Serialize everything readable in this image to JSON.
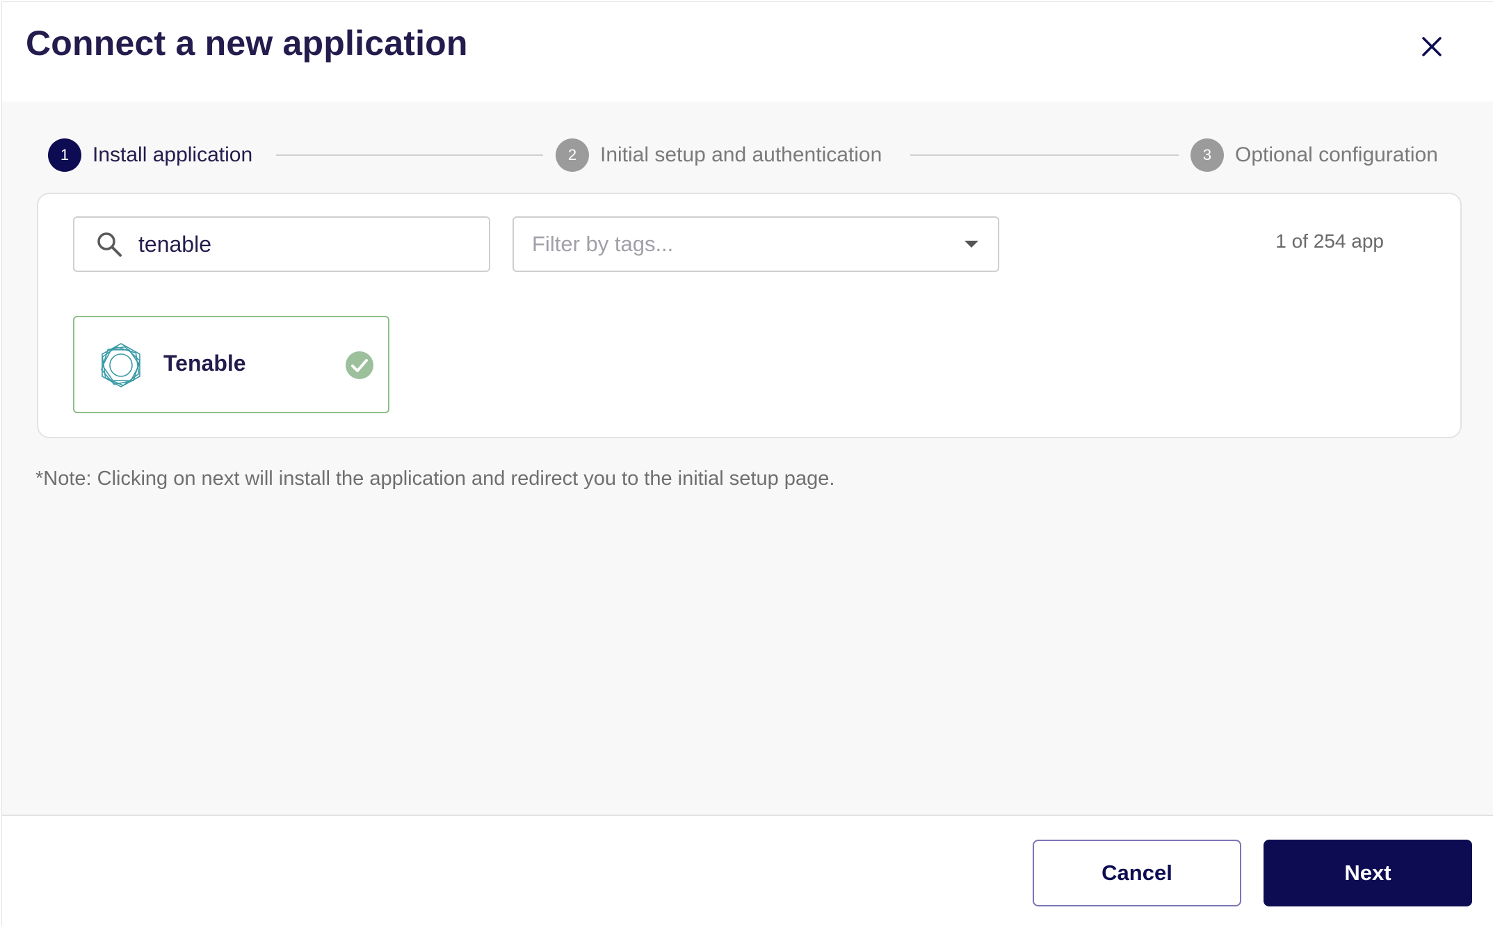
{
  "dialog": {
    "title": "Connect a new application",
    "close_icon": "close-icon"
  },
  "stepper": {
    "steps": [
      {
        "number": "1",
        "label": "Install application",
        "state": "active"
      },
      {
        "number": "2",
        "label": "Initial setup and authentication",
        "state": "inactive"
      },
      {
        "number": "3",
        "label": "Optional configuration",
        "state": "inactive"
      }
    ]
  },
  "search": {
    "value": "tenable",
    "icon": "search-icon"
  },
  "filter": {
    "placeholder": "Filter by tags..."
  },
  "results": {
    "count_text": "1 of 254 app",
    "apps": [
      {
        "name": "Tenable",
        "selected": true,
        "icon": "tenable-logo-icon"
      }
    ]
  },
  "note": "*Note: Clicking on next will install the application and redirect you to the initial setup page.",
  "footer": {
    "cancel_label": "Cancel",
    "next_label": "Next"
  },
  "colors": {
    "primary": "#0d0c52",
    "title": "#231c4d",
    "selected_border": "#8bbf8b",
    "check_fill": "#9cbf9c"
  }
}
